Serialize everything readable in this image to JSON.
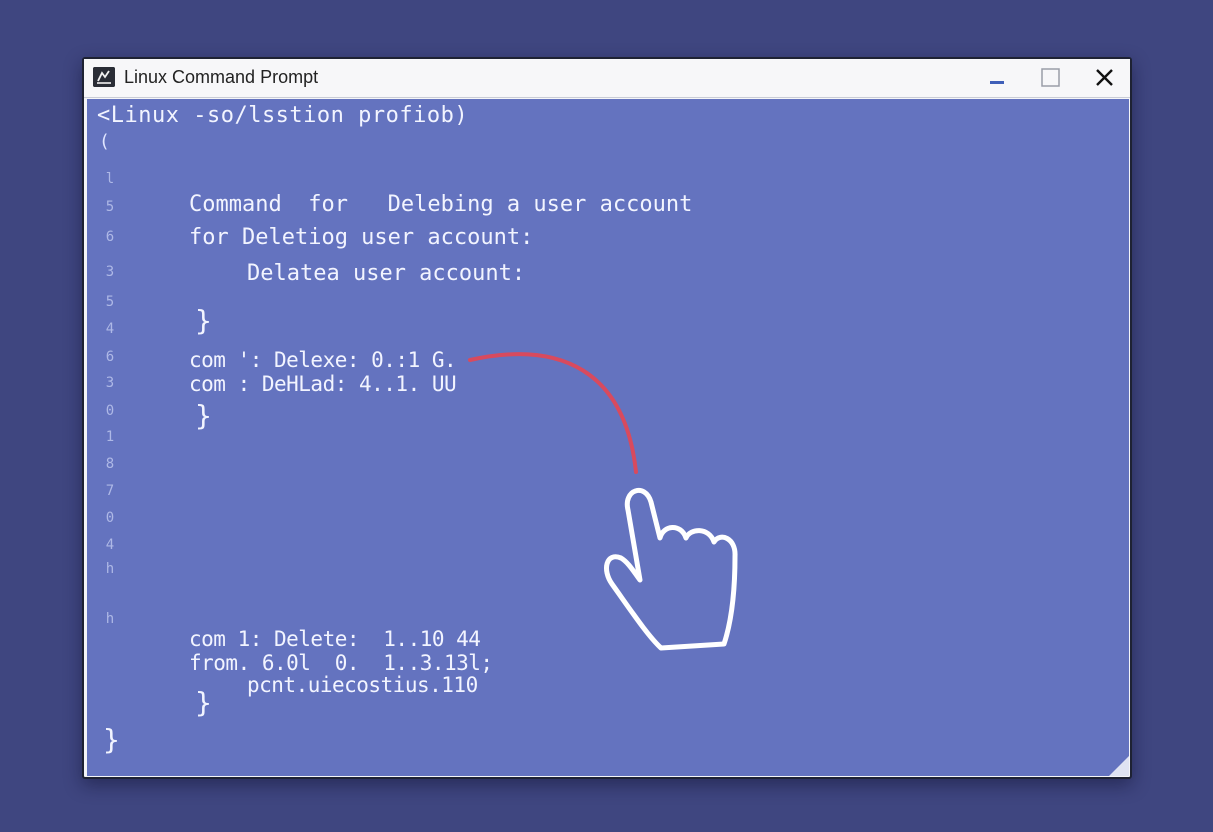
{
  "window": {
    "title": "Linux Command Prompt",
    "icons": {
      "app": "terminal-icon",
      "minimize": "minimize-icon",
      "maximize": "maximize-icon",
      "close": "close-icon"
    }
  },
  "terminal": {
    "header_line": "<Linux -so/lsstion profiob)",
    "header_sub": "(",
    "gutter": [
      "l",
      "5",
      "6",
      "3",
      "5",
      "4",
      "6",
      "3",
      "0",
      "1",
      "8",
      "7",
      "0",
      "4",
      "h",
      "h"
    ],
    "block1": {
      "line1": "Command  for   Delebing a user account",
      "line2": "for Deletiog user account:",
      "line3": "Delatea user account:",
      "close_brace": "}"
    },
    "block2": {
      "line1": "com ': Delexe: 0.:1 G.",
      "line2": "com : DeHLad: 4..1. UU",
      "close_brace": "}"
    },
    "block3": {
      "line1": "com 1: Delete:  1..10 44",
      "line2": "from. 6.0l  0.  1..3.13l;",
      "line3": "pcnt.uiecostius.110",
      "close_brace": "}"
    },
    "final_brace": "}"
  },
  "annotation": {
    "arrow_color": "#d84a5e",
    "cursor_icon": "hand-pointer-icon"
  }
}
